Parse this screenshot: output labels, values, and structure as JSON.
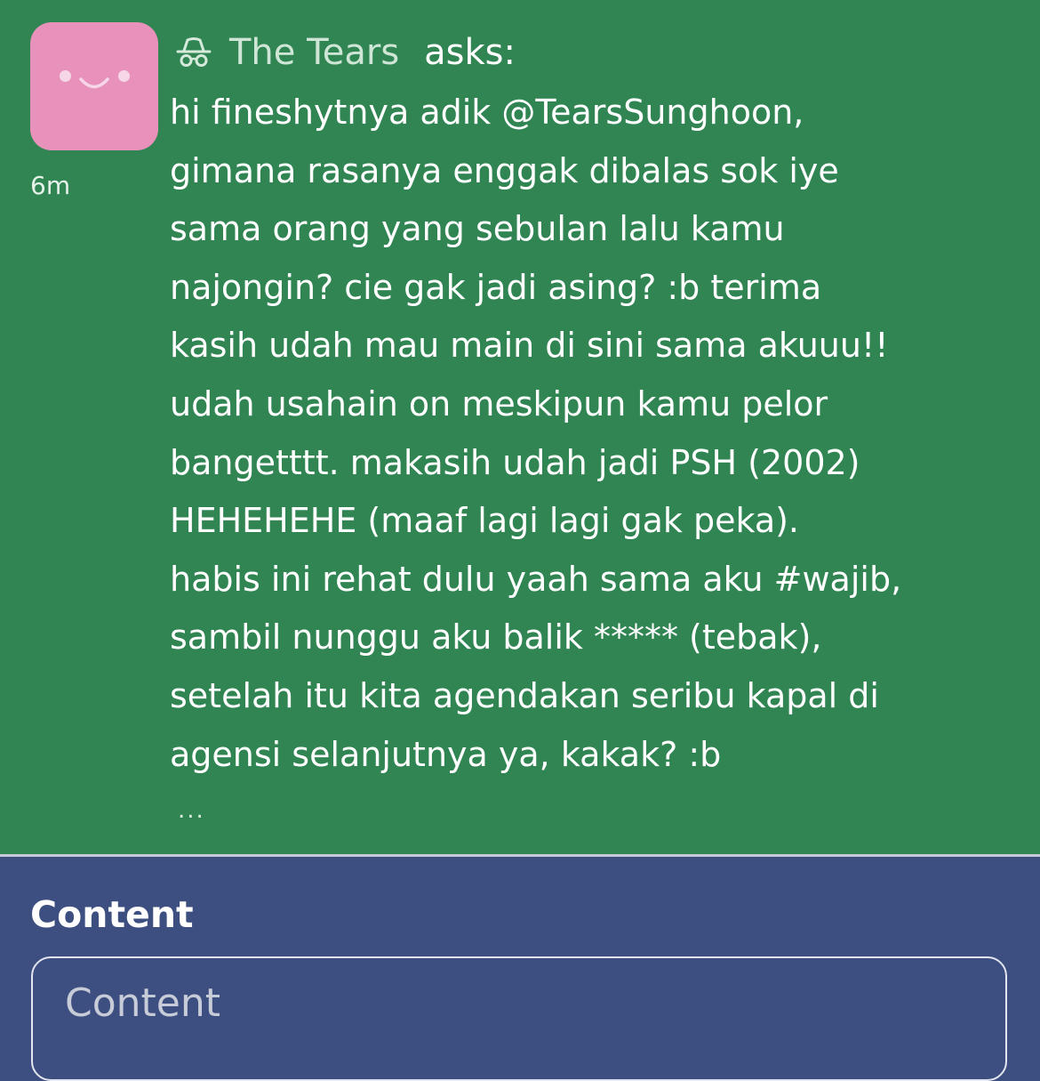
{
  "ask": {
    "asker_icon": "anonymous-incognito-icon",
    "asker_name": "The Tears",
    "asks_label": "asks:",
    "timestamp": "6m",
    "avatar_icon": "smiley-face-icon",
    "question_lines": [
      "hi fineshytnya adik @TearsSunghoon,",
      "gimana rasanya enggak dibalas sok iye",
      "sama orang yang sebulan lalu kamu",
      "najongin? cie gak jadi asing? :b terima",
      "kasih udah mau main di sini sama akuuu!!",
      "udah usahain on meskipun kamu pelor",
      "bangetttt. makasih udah jadi PSH (2002)",
      "HEHEHEHE (maaf lagi lagi gak peka).",
      "habis ini rehat dulu yaah sama aku #wajib,",
      "sambil nunggu aku balik ***** (tebak),",
      "setelah itu kita agendakan seribu kapal di",
      "agensi selanjutnya ya, kakak? :b"
    ],
    "more_icon": "ellipsis-icon",
    "more_label": "..."
  },
  "content": {
    "label": "Content",
    "placeholder": "Content",
    "value": ""
  },
  "colors": {
    "ask_background": "#308553",
    "avatar_background": "#e892bb",
    "page_background": "#3d4f80",
    "divider": "#c7cbd9"
  }
}
